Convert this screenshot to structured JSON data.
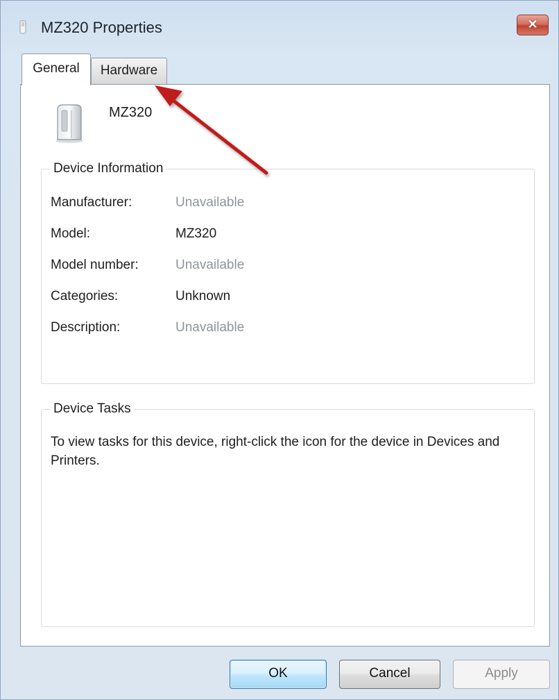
{
  "window": {
    "title": "MZ320 Properties",
    "close_label": "✕"
  },
  "tabs": [
    {
      "label": "General",
      "selected": true
    },
    {
      "label": "Hardware",
      "selected": false
    }
  ],
  "device": {
    "name": "MZ320",
    "icon": "printer-device-icon"
  },
  "device_information": {
    "legend": "Device Information",
    "rows": [
      {
        "label": "Manufacturer:",
        "value": "Unavailable",
        "muted": true
      },
      {
        "label": "Model:",
        "value": "MZ320",
        "muted": false
      },
      {
        "label": "Model number:",
        "value": "Unavailable",
        "muted": true
      },
      {
        "label": "Categories:",
        "value": "Unknown",
        "muted": false
      },
      {
        "label": "Description:",
        "value": "Unavailable",
        "muted": true
      }
    ]
  },
  "device_tasks": {
    "legend": "Device Tasks",
    "text": "To view tasks for this device, right-click the icon for the device in Devices and Printers."
  },
  "buttons": {
    "ok": "OK",
    "cancel": "Cancel",
    "apply": "Apply"
  },
  "annotation": {
    "arrow_color": "#c01e1e",
    "points_to": "Hardware tab"
  }
}
